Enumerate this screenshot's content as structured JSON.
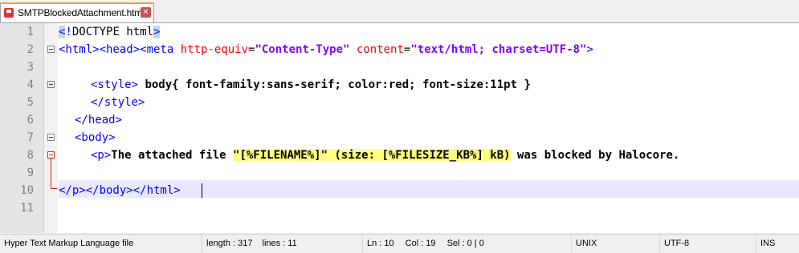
{
  "tab": {
    "title": "SMTPBlockedAttachment.html",
    "close": "✕"
  },
  "lines": {
    "1": "1",
    "2": "2",
    "3": "3",
    "4": "4",
    "5": "5",
    "6": "6",
    "7": "7",
    "8": "8",
    "9": "9",
    "10": "10",
    "11": "11"
  },
  "code": {
    "l1_lt": "<",
    "l1_bang": "!",
    "l1_doctype": "DOCTYPE html",
    "l1_gt": ">",
    "l2_tags": "<html><head><meta ",
    "l2_attr1": "http-equiv",
    "l2_eq1": "=",
    "l2_val1": "\"Content-Type\"",
    "l2_attr2": " content",
    "l2_eq2": "=",
    "l2_val2": "\"text/html; charset=UTF-8\"",
    "l2_end": ">",
    "l4_open": "<style>",
    "l4_text": " body{ font-family:sans-serif; color:red; font-size:11pt }",
    "l5": "</style>",
    "l6": "</head>",
    "l7": "<body>",
    "l8_open": "<p>",
    "l8_text1": "The attached file ",
    "l8_hl": "\"[%FILENAME%]\" (size: [%FILESIZE_KB%] kB)",
    "l8_text2": " was blocked by Halocore.",
    "l10": "</p></body></html>"
  },
  "status": {
    "filetype": "Hyper Text Markup Language file",
    "length": "length : 317",
    "lines": "lines : 11",
    "ln": "Ln : 10",
    "col": "Col : 19",
    "sel": "Sel : 0 | 0",
    "eol": "UNIX",
    "encoding": "UTF-8",
    "mode": "INS"
  }
}
